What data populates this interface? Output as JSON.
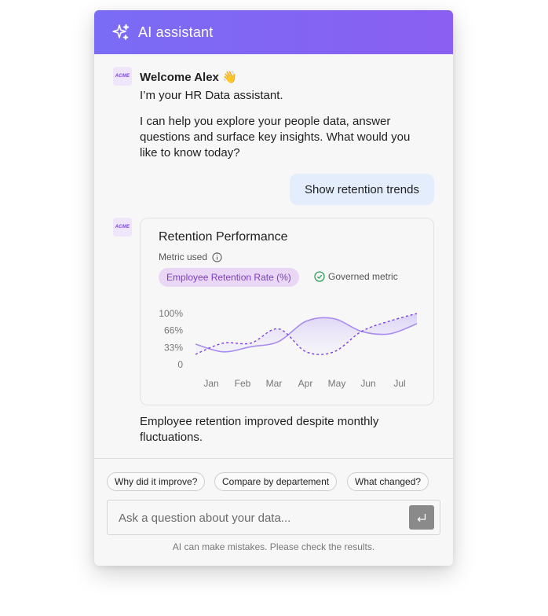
{
  "header": {
    "title": "AI assistant",
    "icon": "sparkles-icon"
  },
  "assistant_avatar": {
    "label": "ACME"
  },
  "messages": {
    "welcome_title": "Welcome Alex 👋",
    "intro_line": "I’m your HR Data assistant.",
    "intro_body": "I can help you explore your people data, answer questions and surface key insights. What would you like to know today?",
    "user_message": "Show retention trends",
    "summary": "Employee retention improved despite monthly fluctuations."
  },
  "card": {
    "title": "Retention Performance",
    "metric_used_label": "Metric used",
    "metric_name": "Employee Retention Rate (%)",
    "governed_label": "Governed metric"
  },
  "chart_data": {
    "type": "line",
    "x": [
      "Jan",
      "Feb",
      "Mar",
      "Apr",
      "May",
      "Jun",
      "Jul"
    ],
    "y_ticks": [
      "100%",
      "66%",
      "33%",
      "0"
    ],
    "ylim": [
      0,
      100
    ],
    "series": [
      {
        "style": "solid",
        "color": "#a98cf0",
        "values": [
          40,
          25,
          35,
          45,
          85,
          90,
          65,
          60,
          80
        ]
      },
      {
        "style": "dashed",
        "color": "#7b3fe4",
        "values": [
          20,
          42,
          42,
          70,
          25,
          25,
          65,
          85,
          100
        ]
      }
    ]
  },
  "suggestions": [
    "Why did it improve?",
    "Compare by departement",
    "What changed?"
  ],
  "composer": {
    "placeholder": "Ask a question about your data...",
    "send_icon": "enter-icon"
  },
  "disclaimer": "AI can make mistakes. Please check the results.",
  "colors": {
    "brand": "#7b3fe4",
    "header_start": "#7a6cf5",
    "header_end": "#8a5ff1",
    "governed": "#2e9e58"
  }
}
